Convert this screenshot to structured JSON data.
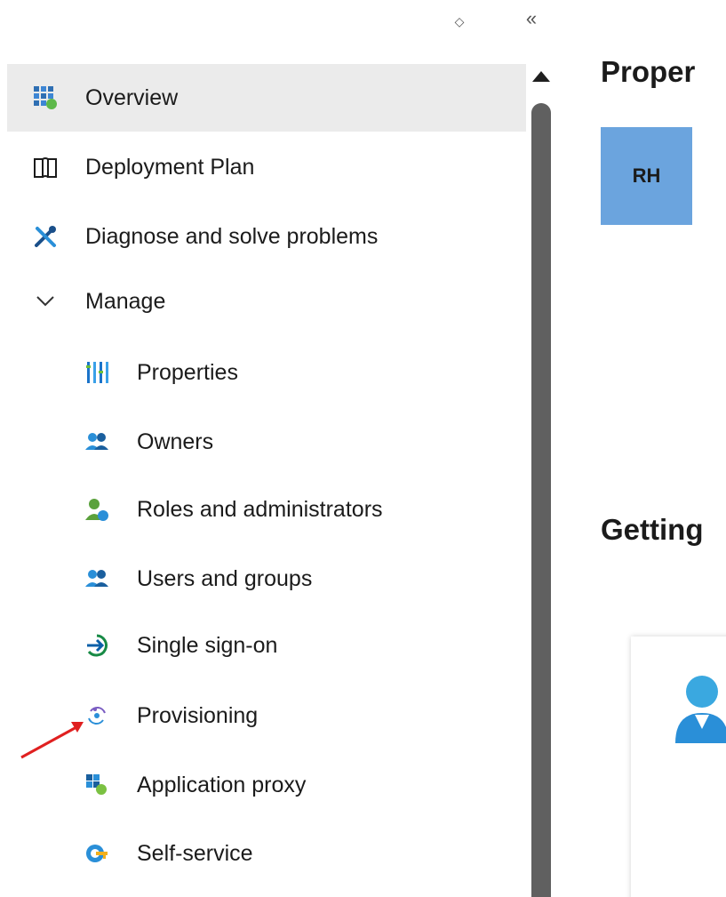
{
  "top_controls": {
    "expand_collapse_glyph": "◇",
    "collapse_sidebar_glyph": "«"
  },
  "sidebar": {
    "items": [
      {
        "label": "Overview",
        "icon": "overview-grid-icon",
        "active": true
      },
      {
        "label": "Deployment Plan",
        "icon": "book-icon"
      },
      {
        "label": "Diagnose and solve problems",
        "icon": "wrench-cross-icon"
      },
      {
        "label": "Manage",
        "icon": "chevron-down-icon",
        "expanded": true
      },
      {
        "label": "Properties",
        "icon": "properties-bars-icon"
      },
      {
        "label": "Owners",
        "icon": "owners-icon"
      },
      {
        "label": "Roles and administrators",
        "icon": "roles-icon"
      },
      {
        "label": "Users and groups",
        "icon": "users-groups-icon"
      },
      {
        "label": "Single sign-on",
        "icon": "sso-arrow-icon"
      },
      {
        "label": "Provisioning",
        "icon": "provisioning-icon"
      },
      {
        "label": "Application proxy",
        "icon": "app-proxy-icon"
      },
      {
        "label": "Self-service",
        "icon": "self-service-icon"
      }
    ]
  },
  "main": {
    "properties_heading": "Proper",
    "avatar_initials": "RH",
    "getting_started_heading": "Getting"
  },
  "colors": {
    "active_bg": "#ebebeb",
    "avatar_bg": "#6ba4de",
    "annotation_arrow": "#e02020",
    "azure_blue": "#0078d4"
  }
}
